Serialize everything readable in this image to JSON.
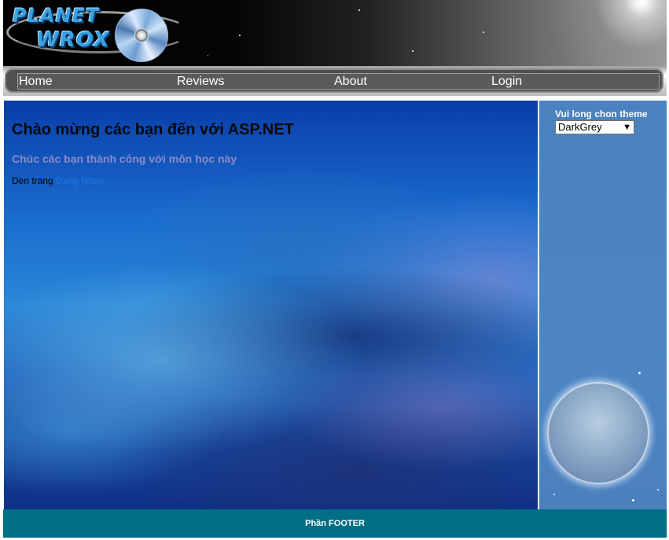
{
  "header": {
    "logo_line1": "PLANET",
    "logo_line2": "WROX"
  },
  "menu": {
    "items": [
      {
        "label": "Home"
      },
      {
        "label": "Reviews"
      },
      {
        "label": "About"
      },
      {
        "label": "Login"
      }
    ]
  },
  "main": {
    "title": "Chào mừng các bạn đến với ASP.NET",
    "subtitle": "Chúc các bạn thành công với môn học này",
    "link_prefix": "Den trang",
    "link_text": "Dang Nhap"
  },
  "sidebar": {
    "theme_label": "Vui long chon theme",
    "theme_selected": "DarkGrey"
  },
  "footer": {
    "text": "Phần FOOTER"
  },
  "colors": {
    "footer_bg": "#006e84",
    "sidebar_bg": "#4a82c0",
    "menu_bg": "#505050",
    "link": "#1a78e8"
  }
}
